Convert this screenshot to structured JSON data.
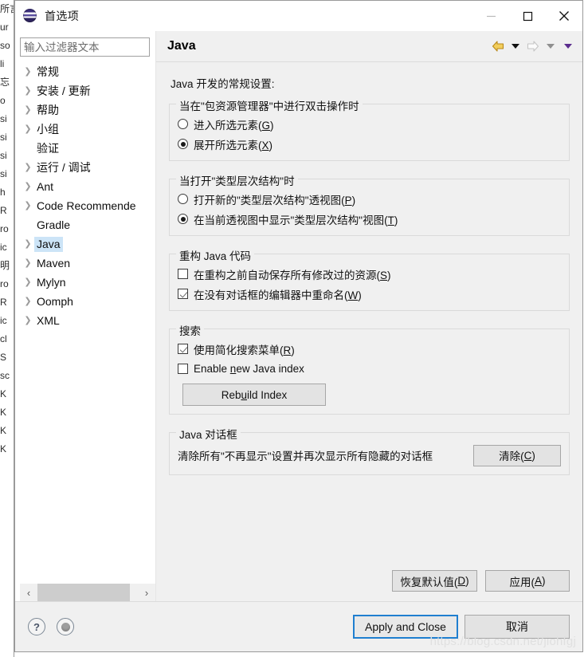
{
  "window": {
    "title": "首选项",
    "app_icon": "eclipse-globe-icon",
    "controls": {
      "minimize": "—",
      "maximize": "□",
      "close": "✕"
    }
  },
  "sidebar": {
    "filter_placeholder": "输入过滤器文本",
    "filter_value": "",
    "items": [
      {
        "label": "常规",
        "expandable": true,
        "selected": false
      },
      {
        "label": "安装 / 更新",
        "expandable": true,
        "selected": false
      },
      {
        "label": "帮助",
        "expandable": true,
        "selected": false
      },
      {
        "label": "小组",
        "expandable": true,
        "selected": false
      },
      {
        "label": "验证",
        "expandable": false,
        "selected": false
      },
      {
        "label": "运行 / 调试",
        "expandable": true,
        "selected": false
      },
      {
        "label": "Ant",
        "expandable": true,
        "selected": false
      },
      {
        "label": "Code Recommende",
        "expandable": true,
        "selected": false
      },
      {
        "label": "Gradle",
        "expandable": false,
        "selected": false
      },
      {
        "label": "Java",
        "expandable": true,
        "selected": true
      },
      {
        "label": "Maven",
        "expandable": true,
        "selected": false
      },
      {
        "label": "Mylyn",
        "expandable": true,
        "selected": false
      },
      {
        "label": "Oomph",
        "expandable": true,
        "selected": false
      },
      {
        "label": "XML",
        "expandable": true,
        "selected": false
      }
    ],
    "scrollbar": {
      "left_arrow": "‹",
      "right_arrow": "›"
    }
  },
  "content": {
    "title": "Java",
    "nav": {
      "back_icon": "back-arrow-icon",
      "back_menu_icon": "caret-down-icon",
      "forward_icon": "forward-arrow-icon",
      "forward_menu_icon": "caret-down-icon",
      "view_menu_icon": "caret-down-icon"
    },
    "intro": "Java 开发的常规设置:",
    "groups": [
      {
        "title": "当在\"包资源管理器\"中进行双击操作时",
        "options": [
          {
            "type": "radio",
            "checked": false,
            "text": "进入所选元素(",
            "mnemonic": "G",
            "suffix": ")"
          },
          {
            "type": "radio",
            "checked": true,
            "text": "展开所选元素(",
            "mnemonic": "X",
            "suffix": ")"
          }
        ]
      },
      {
        "title": "当打开\"类型层次结构\"时",
        "options": [
          {
            "type": "radio",
            "checked": false,
            "text": "打开新的\"类型层次结构\"透视图(",
            "mnemonic": "P",
            "suffix": ")"
          },
          {
            "type": "radio",
            "checked": true,
            "text": "在当前透视图中显示\"类型层次结构\"视图(",
            "mnemonic": "T",
            "suffix": ")"
          }
        ]
      },
      {
        "title": "重构 Java 代码",
        "options": [
          {
            "type": "checkbox",
            "checked": false,
            "text": "在重构之前自动保存所有修改过的资源(",
            "mnemonic": "S",
            "suffix": ")"
          },
          {
            "type": "checkbox",
            "checked": true,
            "text": "在没有对话框的编辑器中重命名(",
            "mnemonic": "W",
            "suffix": ")"
          }
        ]
      },
      {
        "title": "搜索",
        "options": [
          {
            "type": "checkbox",
            "checked": true,
            "text": "使用简化搜索菜单(",
            "mnemonic": "R",
            "suffix": ")"
          },
          {
            "type": "checkbox",
            "checked": false,
            "text": "Enable ",
            "mnemonic": "n",
            "suffix": "ew Java index"
          }
        ],
        "button": {
          "label_pre": "Reb",
          "mnemonic": "u",
          "label_post": "ild Index"
        }
      },
      {
        "title": "Java 对话框",
        "description": "清除所有\"不再显示\"设置并再次显示所有隐藏的对话框",
        "button": {
          "label_pre": "清除(",
          "mnemonic": "C",
          "label_post": ")"
        }
      }
    ]
  },
  "footer": {
    "restore_defaults": {
      "pre": "恢复默认值(",
      "mnemonic": "D",
      "post": ")"
    },
    "apply": {
      "pre": "应用(",
      "mnemonic": "A",
      "post": ")"
    },
    "help_icon": "?",
    "shell_icon": "shell-status-icon",
    "apply_and_close": "Apply and Close",
    "cancel": "取消"
  },
  "watermark": "https://blog.csdn.net/jiohfgj",
  "background": {
    "left_column": "所言蚀蚀项 ur so li 忘 o si si si si h R ro ic 明 ro R ic cl S sc K K K K",
    "right_column": ""
  },
  "colors": {
    "dialog_bg": "#f0f0f0",
    "titlebar_bg": "#ffffff",
    "tree_selection": "#cce4f7",
    "default_button_border": "#1f7fd0",
    "back_arrow": "#e0a81e",
    "forward_arrow": "#c9c9c9",
    "view_menu_caret": "#5b2d8e"
  }
}
